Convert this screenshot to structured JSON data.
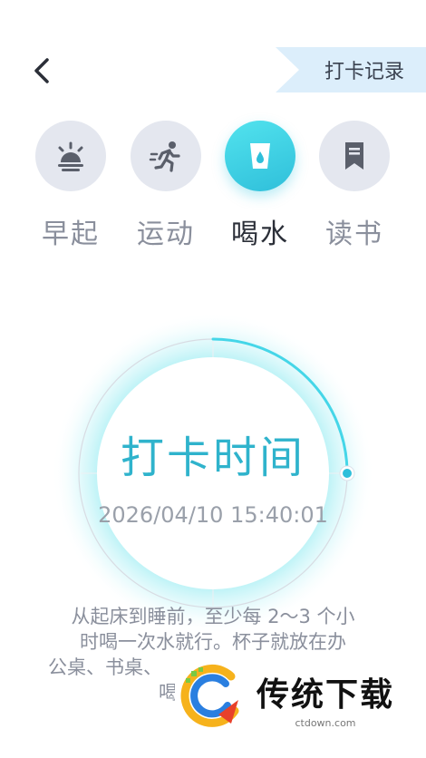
{
  "header": {
    "record_label": "打卡记录"
  },
  "categories": [
    {
      "label": "早起",
      "icon": "sunrise-icon",
      "active": false
    },
    {
      "label": "运动",
      "icon": "running-icon",
      "active": false
    },
    {
      "label": "喝水",
      "icon": "water-cup-icon",
      "active": true
    },
    {
      "label": "读书",
      "icon": "bookmark-icon",
      "active": false
    }
  ],
  "clock": {
    "title": "打卡时间",
    "datetime": "2026/04/10 15:40:01"
  },
  "description": {
    "line1": "从起床到睡前，至少每 2～3 个小",
    "line2": "时喝一次水就行。杯子就放在办",
    "line3": "公桌、书桌、",
    "line4": "喝"
  },
  "watermark": {
    "title": "传统下载",
    "url": "ctdown.com"
  },
  "colors": {
    "accent": "#2fbfda",
    "accent_light": "#52e3ee",
    "inactive_circle": "#e4e7ef",
    "record_tab_bg": "#dceefb"
  }
}
